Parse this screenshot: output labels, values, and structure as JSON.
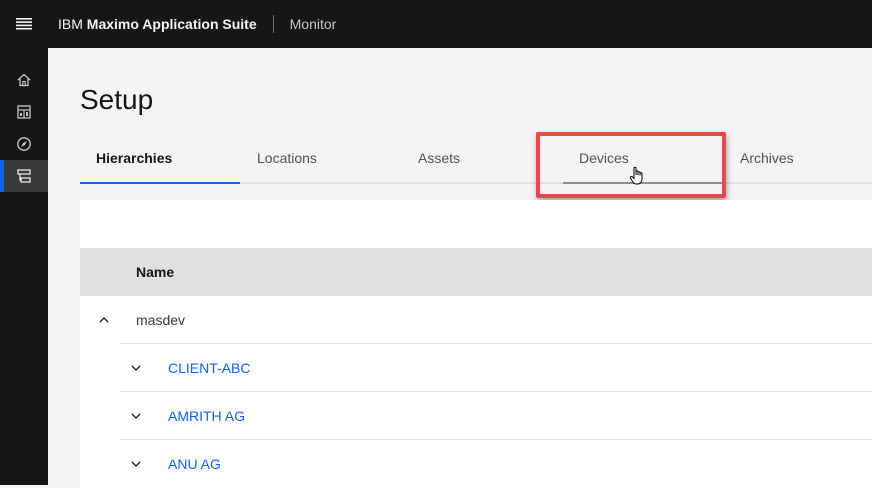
{
  "header": {
    "brand_prefix": "IBM",
    "brand_name": "Maximo Application Suite",
    "app_name": "Monitor"
  },
  "sidenav": {
    "items": [
      {
        "icon": "home-icon"
      },
      {
        "icon": "dashboard-icon"
      },
      {
        "icon": "compass-icon"
      },
      {
        "icon": "hierarchy-icon",
        "active": true
      }
    ]
  },
  "page": {
    "title": "Setup"
  },
  "tabs": [
    {
      "label": "Hierarchies",
      "selected": true
    },
    {
      "label": "Locations"
    },
    {
      "label": "Assets"
    },
    {
      "label": "Devices",
      "highlighted": true
    },
    {
      "label": "Archives"
    }
  ],
  "table": {
    "column_name": "Name",
    "rows": [
      {
        "label": "masdev",
        "expanded": true
      },
      {
        "label": "CLIENT-ABC",
        "expanded": false
      },
      {
        "label": "AMRITH AG",
        "expanded": false
      },
      {
        "label": "ANU AG",
        "expanded": false
      }
    ]
  },
  "colors": {
    "accent": "#0f62fe",
    "highlight_box": "#e5484d",
    "topbar": "#161616"
  }
}
